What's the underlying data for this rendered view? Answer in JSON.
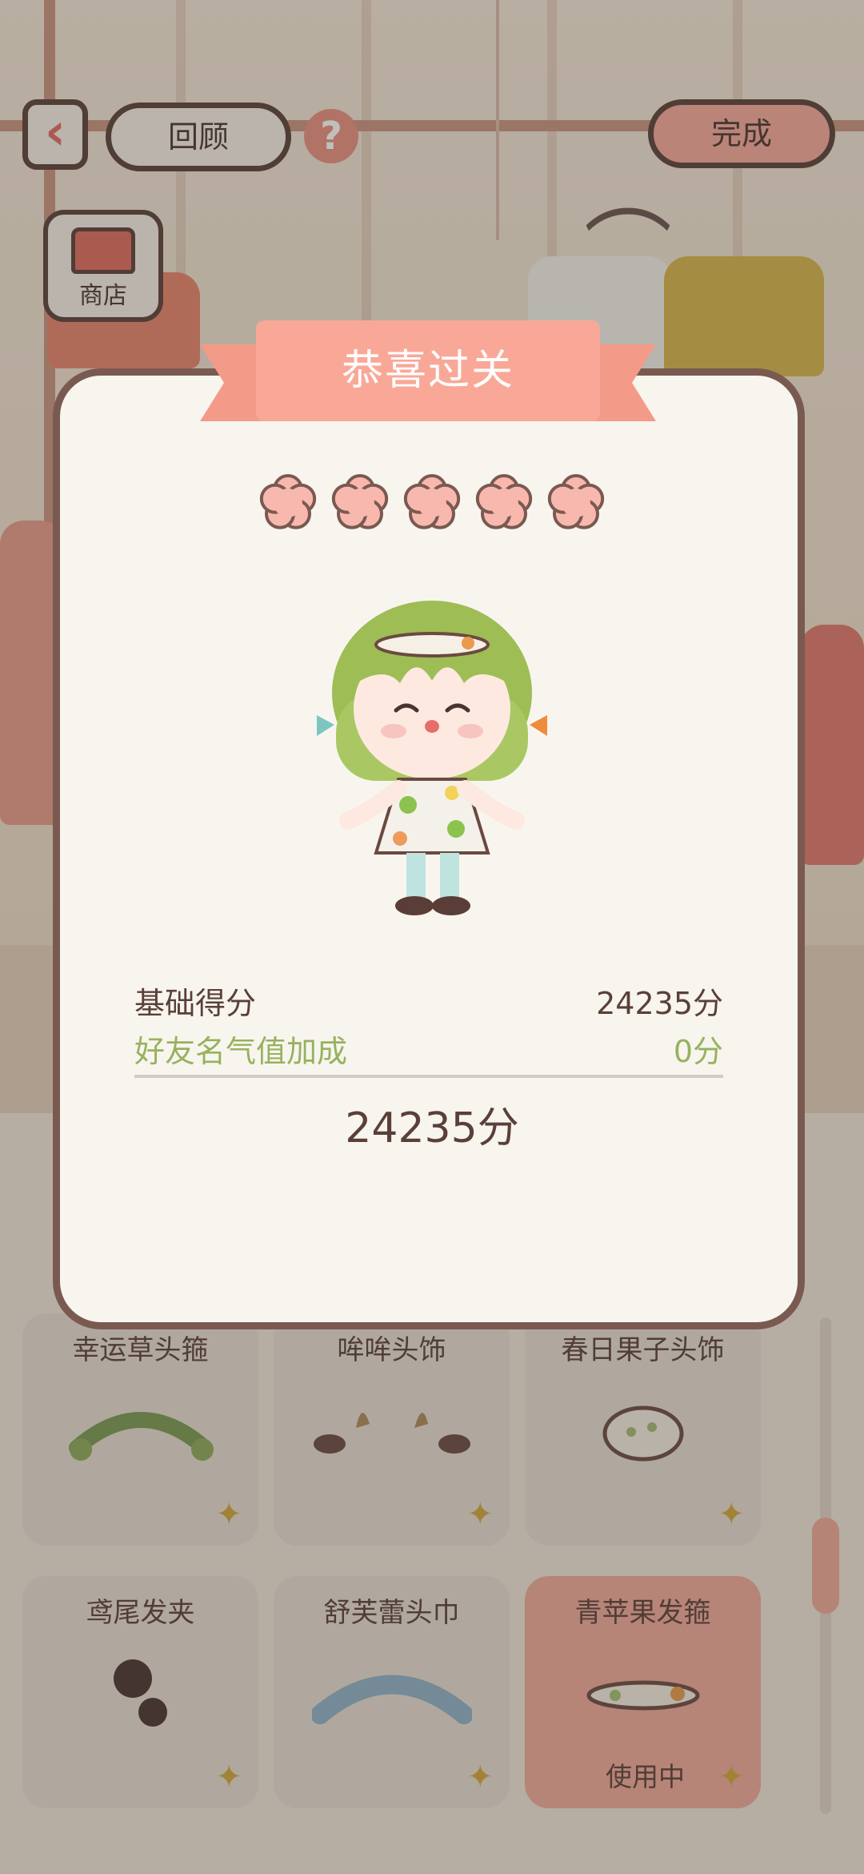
{
  "top_bar": {
    "back_icon": "‹",
    "review_label": "回顾",
    "help_icon": "?",
    "done_label": "完成",
    "shop_label": "商店"
  },
  "items": [
    {
      "name": "幸运草头箍",
      "in_use": false
    },
    {
      "name": "哞哞头饰",
      "in_use": false
    },
    {
      "name": "春日果子头饰",
      "in_use": false
    },
    {
      "name": "鸢尾发夹",
      "in_use": false
    },
    {
      "name": "舒芙蕾头巾",
      "in_use": false
    },
    {
      "name": "青苹果发箍",
      "in_use": true
    }
  ],
  "in_use_label": "使用中",
  "result": {
    "title": "恭喜过关",
    "stars": 5,
    "base_score_label": "基础得分",
    "base_score_value": "24235分",
    "bonus_label": "好友名气值加成",
    "bonus_value": "0分",
    "total": "24235分"
  },
  "colors": {
    "accent": "#f9a898",
    "bonus_green": "#97b25e",
    "star_pink": "#f8b8ae",
    "border_brown": "#7a5a50"
  }
}
